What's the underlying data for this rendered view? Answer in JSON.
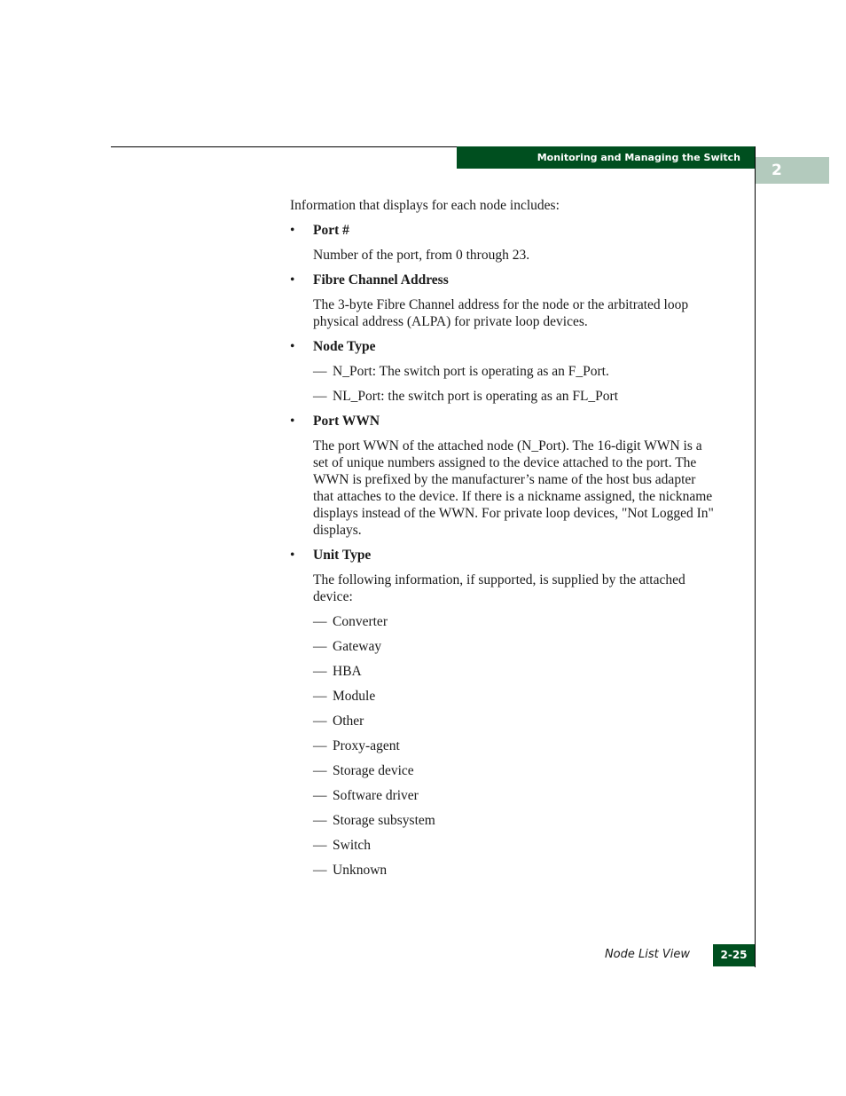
{
  "header": {
    "section_title": "Monitoring and Managing the Switch",
    "chapter_number": "2",
    "colors": {
      "header_bar": "#004f1f",
      "chapter_tab": "#b3cabd"
    }
  },
  "content": {
    "intro": "Information that displays for each node includes:",
    "items": [
      {
        "title": "Port #",
        "paragraphs": [
          "Number of the port, from 0 through 23."
        ],
        "dash_items": []
      },
      {
        "title": "Fibre Channel Address",
        "paragraphs": [
          "The 3-byte Fibre Channel address for the node or the arbitrated loop physical address (ALPA) for private loop devices."
        ],
        "dash_items": []
      },
      {
        "title": "Node Type",
        "paragraphs": [],
        "dash_items": [
          "N_Port: The switch port is operating as an F_Port.",
          "NL_Port: the switch port is operating as an FL_Port"
        ]
      },
      {
        "title": "Port WWN",
        "paragraphs": [
          "The port WWN of the attached node (N_Port). The 16-digit WWN is a set of unique numbers assigned to the device attached to the port. The WWN is prefixed by the manufacturer’s name of the host bus adapter that attaches to the device. If there is a nickname assigned, the nickname displays instead of the WWN. For private loop devices, \"Not Logged In\" displays."
        ],
        "dash_items": []
      },
      {
        "title": "Unit Type",
        "paragraphs": [
          "The following information, if supported, is supplied by the attached device:"
        ],
        "dash_items": [
          "Converter",
          "Gateway",
          "HBA",
          "Module",
          "Other",
          "Proxy-agent",
          "Storage device",
          "Software driver",
          "Storage subsystem",
          "Switch",
          "Unknown"
        ]
      }
    ],
    "bullet_glyph": "•",
    "dash_glyph": "—"
  },
  "footer": {
    "section_name": "Node List View",
    "page_number": "2-25"
  }
}
